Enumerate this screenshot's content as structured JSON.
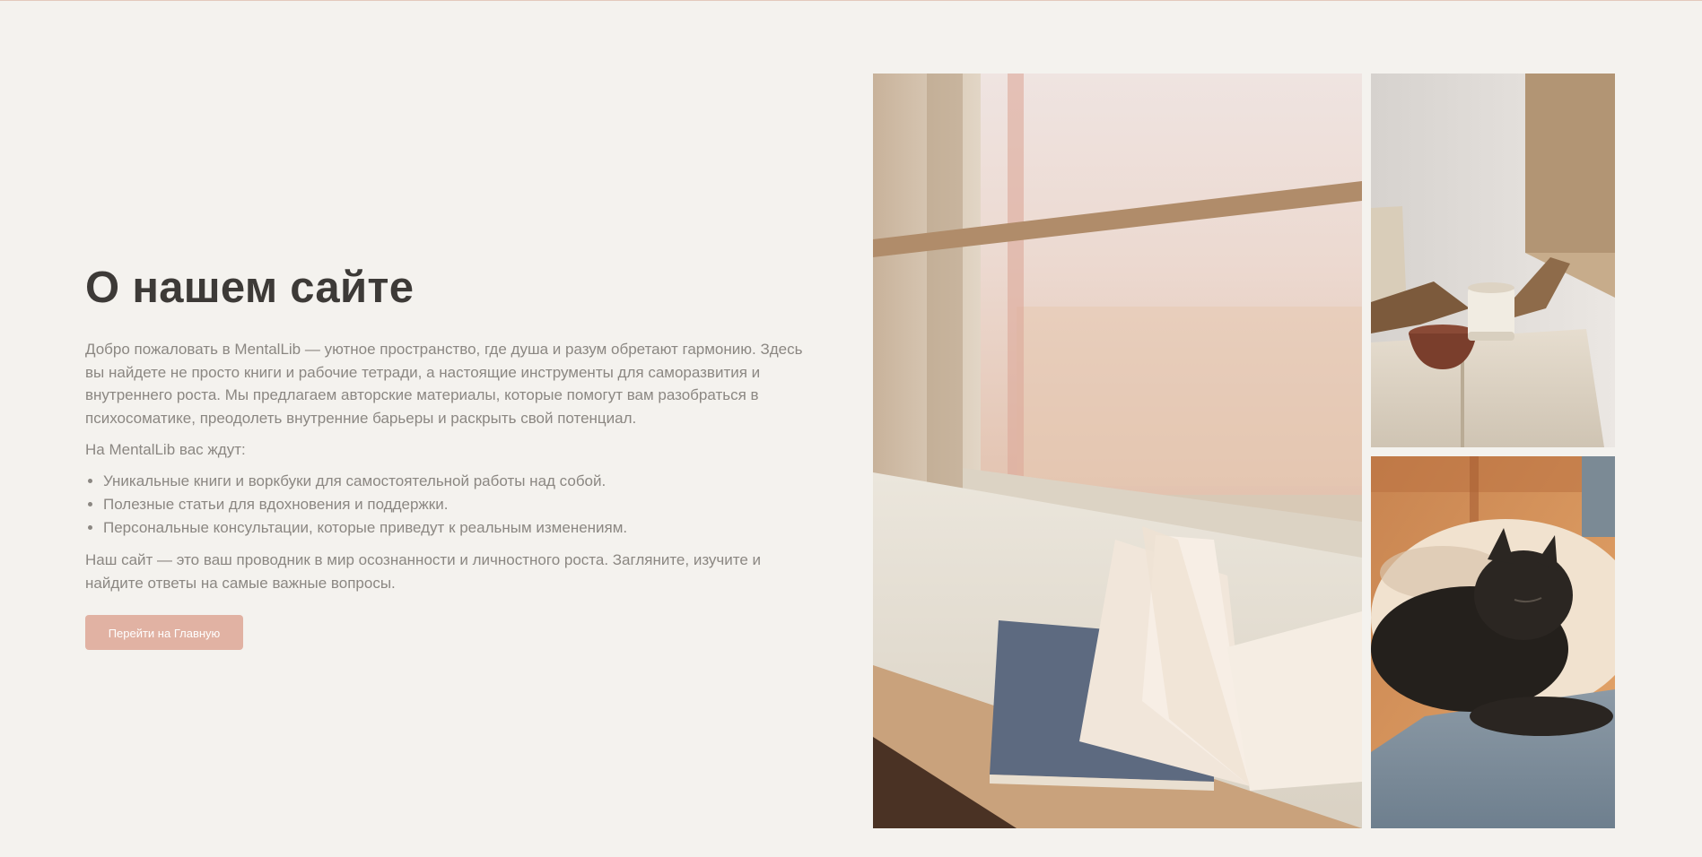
{
  "about": {
    "title": "О нашем сайте",
    "intro": "Добро пожаловать в MentalLib — уютное пространство, где душа и разум обретают гармонию. Здесь вы найдете не просто книги и рабочие тетради, а настоящие инструменты для саморазвития и внутреннего роста. Мы предлагаем авторские материалы, которые помогут вам разобраться в психосоматике, преодолеть внутренние барьеры и раскрыть свой потенциал.",
    "lead": "На MentalLib вас ждут:",
    "features": [
      "Уникальные книги и воркбуки для самостоятельной работы над собой.",
      "Полезные статьи для вдохновения и поддержки.",
      "Персональные консультации, которые приведут к реальным изменениям."
    ],
    "outro": "Наш сайт — это ваш проводник в мир осознанности и личностного роста. Загляните, изучите и найдите ответы на самые важные вопросы.",
    "cta_label": "Перейти на Главную"
  },
  "colors": {
    "background": "#f4f2ee",
    "heading": "#3d3a37",
    "body_text": "#8b8782",
    "accent_button": "#e1b2a3"
  }
}
